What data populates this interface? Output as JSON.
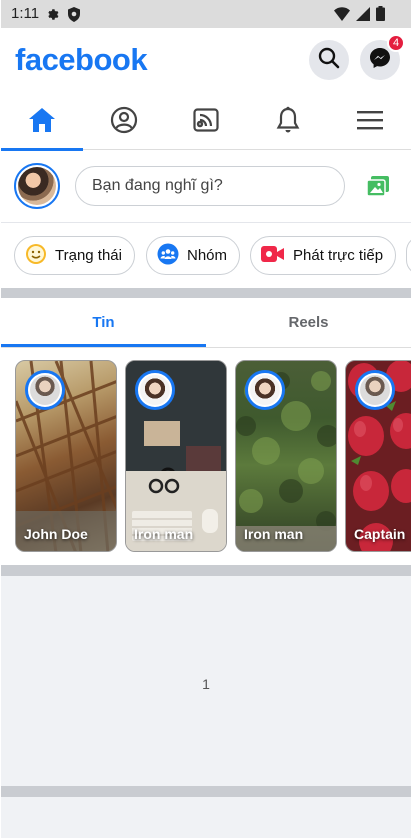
{
  "status_bar": {
    "time": "1:11",
    "icons": [
      "gear-icon",
      "shield-icon",
      "wifi-icon",
      "signal-icon",
      "battery-icon"
    ]
  },
  "header": {
    "logo": "facebook",
    "brand_color": "#1877f2",
    "search_icon": "search-icon",
    "messenger_icon": "messenger-icon",
    "messenger_badge": "4"
  },
  "nav": {
    "tabs": [
      {
        "name": "home",
        "icon": "home-icon",
        "active": true
      },
      {
        "name": "profile",
        "icon": "profile-icon",
        "active": false
      },
      {
        "name": "watch",
        "icon": "video-feed-icon",
        "active": false
      },
      {
        "name": "notifications",
        "icon": "bell-icon",
        "active": false
      },
      {
        "name": "menu",
        "icon": "menu-icon",
        "active": false
      }
    ]
  },
  "composer": {
    "placeholder": "Bạn đang nghĩ gì?",
    "photo_icon": "photo-icon"
  },
  "chips": [
    {
      "label": "Trạng thái",
      "icon": "smiley-icon"
    },
    {
      "label": "Nhóm",
      "icon": "group-icon"
    },
    {
      "label": "Phát trực tiếp",
      "icon": "live-video-icon"
    }
  ],
  "stories_tabs": {
    "active": "Tin",
    "inactive": "Reels"
  },
  "stories": [
    {
      "name": "John Doe"
    },
    {
      "name": "Iron man"
    },
    {
      "name": "Iron man"
    },
    {
      "name": "Captain"
    }
  ],
  "feed": {
    "page_number": "1"
  }
}
